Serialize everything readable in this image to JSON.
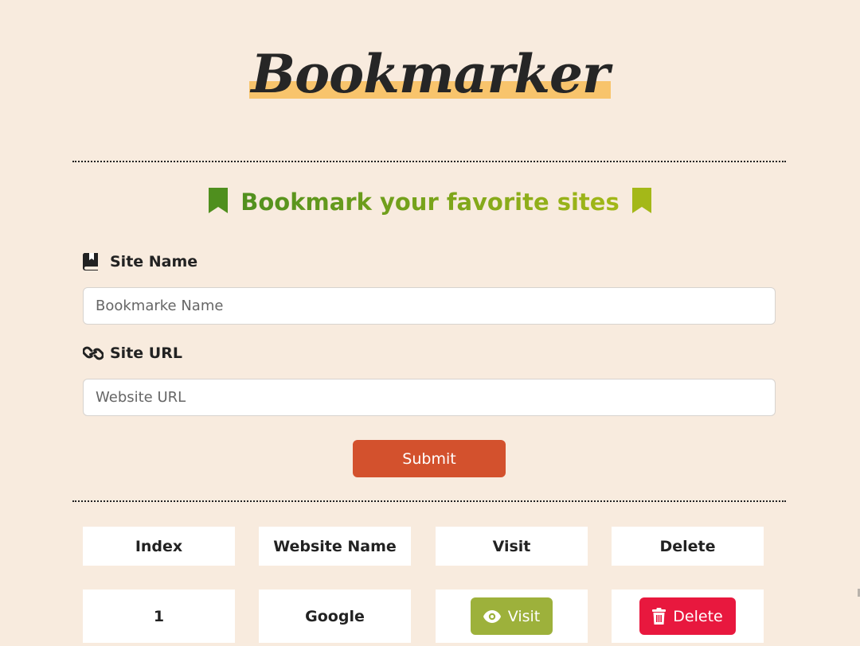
{
  "app": {
    "title": "Bookmarker"
  },
  "form": {
    "heading": "Bookmark your favorite sites",
    "site_name_label": "Site Name",
    "site_name_placeholder": "Bookmarke Name",
    "site_name_value": "",
    "site_url_label": "Site URL",
    "site_url_placeholder": "Website URL",
    "site_url_value": "",
    "submit_label": "Submit"
  },
  "table": {
    "headers": [
      "Index",
      "Website Name",
      "Visit",
      "Delete"
    ],
    "rows": [
      {
        "index": "1",
        "name": "Google",
        "visit_label": "Visit",
        "delete_label": "Delete"
      }
    ]
  },
  "icons": {
    "heading_left": "bookmark-icon",
    "heading_right": "bookmark-icon",
    "site_name": "book-bookmark-icon",
    "site_url": "link-icon",
    "visit": "eye-icon",
    "delete": "trash-icon"
  },
  "colors": {
    "background": "#f8ebde",
    "logo_highlight": "#f8c46c",
    "heading_green_start": "#4f8f1e",
    "heading_green_end": "#a4b818",
    "submit": "#d3512d",
    "visit": "#9db13b",
    "delete": "#e8183e"
  }
}
